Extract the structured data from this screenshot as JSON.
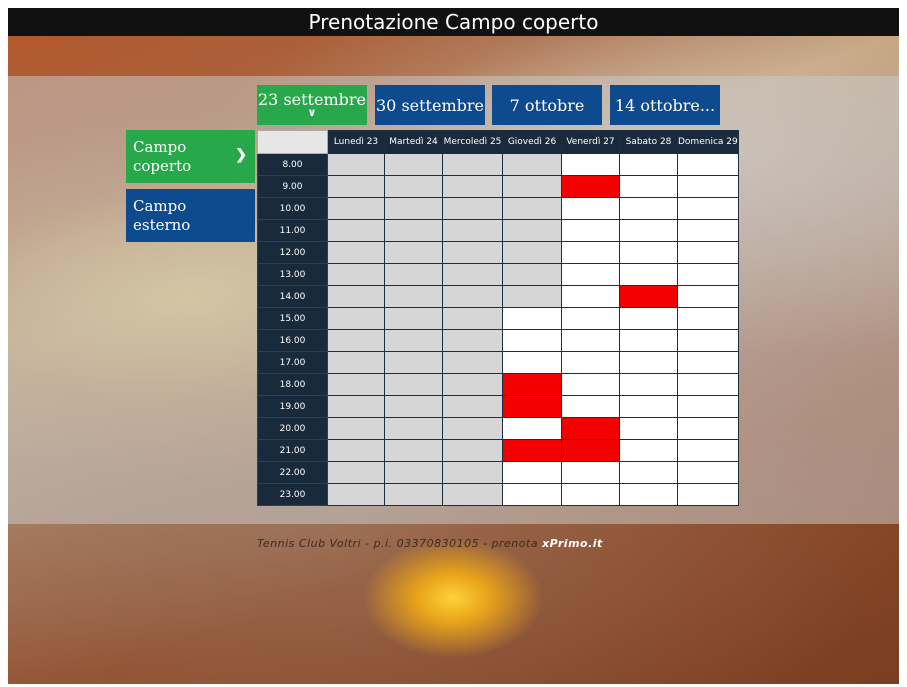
{
  "title": "Prenotazione Campo coperto",
  "weeks": [
    {
      "label": "23 settembre",
      "active": true
    },
    {
      "label": "30 settembre",
      "active": false
    },
    {
      "label": "7 ottobre",
      "active": false
    },
    {
      "label": "14 ottobre...",
      "active": false
    }
  ],
  "courts": [
    {
      "label": "Campo coperto",
      "active": true,
      "color": "#27a84a"
    },
    {
      "label": "Campo esterno",
      "active": false,
      "color": "#0e4a8e"
    }
  ],
  "days": [
    "Lunedì 23",
    "Martedì 24",
    "Mercoledì 25",
    "Giovedì 26",
    "Venerdì 27",
    "Sabato 28",
    "Domenica 29"
  ],
  "hours": [
    "8.00",
    "9.00",
    "10.00",
    "11.00",
    "12.00",
    "13.00",
    "14.00",
    "15.00",
    "16.00",
    "17.00",
    "18.00",
    "19.00",
    "20.00",
    "21.00",
    "22.00",
    "23.00"
  ],
  "slots": [
    [
      "past",
      "past",
      "past",
      "past",
      "free",
      "free",
      "free"
    ],
    [
      "past",
      "past",
      "past",
      "past",
      "booked",
      "free",
      "free"
    ],
    [
      "past",
      "past",
      "past",
      "past",
      "free",
      "free",
      "free"
    ],
    [
      "past",
      "past",
      "past",
      "past",
      "free",
      "free",
      "free"
    ],
    [
      "past",
      "past",
      "past",
      "past",
      "free",
      "free",
      "free"
    ],
    [
      "past",
      "past",
      "past",
      "past",
      "free",
      "free",
      "free"
    ],
    [
      "past",
      "past",
      "past",
      "past",
      "free",
      "booked",
      "free"
    ],
    [
      "past",
      "past",
      "past",
      "free",
      "free",
      "free",
      "free"
    ],
    [
      "past",
      "past",
      "past",
      "free",
      "free",
      "free",
      "free"
    ],
    [
      "past",
      "past",
      "past",
      "free",
      "free",
      "free",
      "free"
    ],
    [
      "past",
      "past",
      "past",
      "booked",
      "free",
      "free",
      "free"
    ],
    [
      "past",
      "past",
      "past",
      "booked",
      "free",
      "free",
      "free"
    ],
    [
      "past",
      "past",
      "past",
      "free",
      "booked",
      "free",
      "free"
    ],
    [
      "past",
      "past",
      "past",
      "booked",
      "booked",
      "free",
      "free"
    ],
    [
      "past",
      "past",
      "past",
      "free",
      "free",
      "free",
      "free"
    ],
    [
      "past",
      "past",
      "past",
      "free",
      "free",
      "free",
      "free"
    ]
  ],
  "footer": {
    "text": "Tennis Club Voltri - p.i. 03370830105 - prenota ",
    "brand": "xPrimo.it"
  },
  "colors": {
    "active": "#27a84a",
    "inactive": "#0e4a8e",
    "booked": "#f50000",
    "past": "#d6d6d6",
    "header": "#1a2a3d"
  }
}
